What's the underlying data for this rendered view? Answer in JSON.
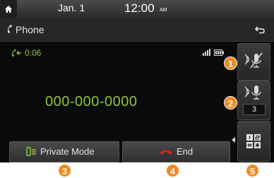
{
  "status_bar": {
    "date": "Jan.  1",
    "time": "12:00",
    "ampm": "AM"
  },
  "title_bar": {
    "title": "Phone"
  },
  "call": {
    "duration": "0:06",
    "number": "000-000-0000"
  },
  "side_buttons": {
    "mic_level": "3"
  },
  "bottom": {
    "private_mode_label": "Private Mode",
    "end_label": "End"
  },
  "callouts": [
    "1",
    "2",
    "3",
    "4",
    "5"
  ],
  "colors": {
    "accent_green": "#8ec63f",
    "callout_orange": "#f28a1e",
    "end_red": "#e02020"
  },
  "icons": [
    "home-icon",
    "phone-handset-icon",
    "back-arrow-icon",
    "outgoing-call-icon",
    "signal-icon",
    "battery-icon",
    "mute-icon",
    "microphone-icon",
    "keypad-icon",
    "private-mode-icon",
    "end-call-icon"
  ]
}
